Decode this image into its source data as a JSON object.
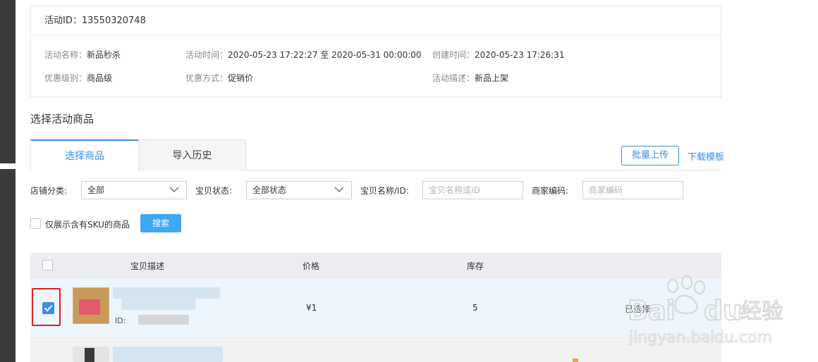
{
  "activity": {
    "id_label": "活动ID：",
    "id_value": "13550320748",
    "name_label": "活动名称：",
    "name_value": "新品秒杀",
    "time_label": "活动时间：",
    "time_value": "2020-05-23 17:22:27 至 2020-05-31 00:00:00",
    "created_label": "创建时间：",
    "created_value": "2020-05-23 17:26:31",
    "level_label": "优惠级别：",
    "level_value": "商品级",
    "method_label": "优惠方式：",
    "method_value": "促销价",
    "desc_label": "活动描述：",
    "desc_value": "新品上架"
  },
  "section_title": "选择活动商品",
  "tabs": [
    {
      "label": "选择商品",
      "active": true
    },
    {
      "label": "导入历史",
      "active": false
    }
  ],
  "actions": {
    "batch_upload": "批量上传",
    "download_template": "下载模板"
  },
  "filters": {
    "shop_category_label": "店铺分类:",
    "shop_category_value": "全部",
    "item_status_label": "宝贝状态:",
    "item_status_value": "全部状态",
    "item_name_label": "宝贝名称/ID:",
    "item_name_placeholder": "宝贝名称或ID",
    "merchant_code_label": "商家编码:",
    "merchant_code_placeholder": "商家编码",
    "sku_only_label": "仅展示含有SKU的商品",
    "search_button": "搜索"
  },
  "table": {
    "columns": [
      "宝贝描述",
      "价格",
      "库存"
    ],
    "rows": [
      {
        "id_prefix": "ID:",
        "price": "¥1",
        "stock": "5",
        "status": "已选择",
        "checked": true
      }
    ]
  },
  "watermark": {
    "brand_left": "Bai",
    "brand_right": "du",
    "brand_cn": "经验",
    "url": "jingyan.baidu.com"
  },
  "colors": {
    "accent": "#3a8ee6",
    "primary_button": "#3da8f5",
    "highlight_box": "#e02020",
    "table_header": "#ebedf0",
    "selected_row": "#edf5fd"
  }
}
